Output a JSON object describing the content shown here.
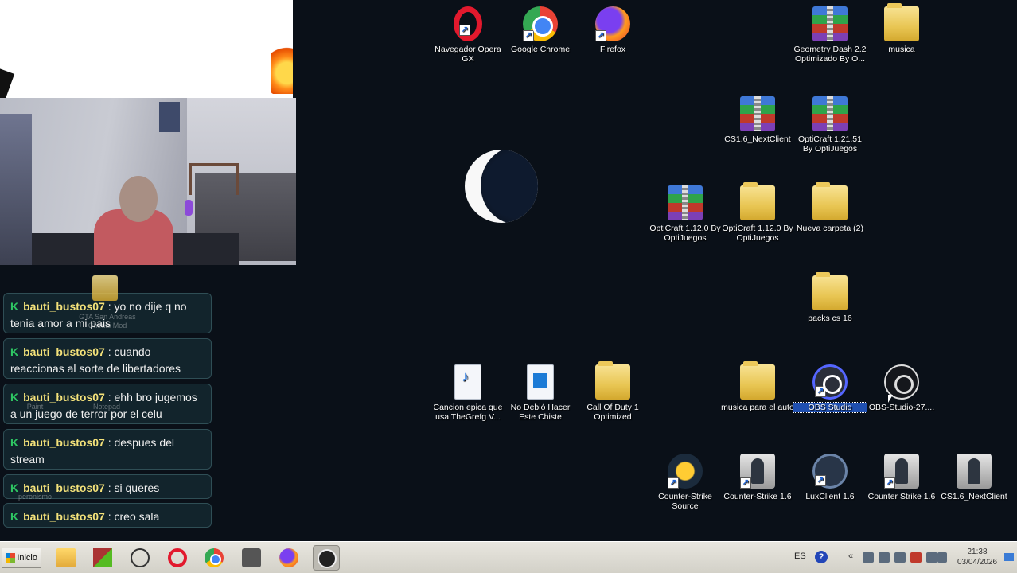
{
  "chat": {
    "badge": "K",
    "messages": [
      {
        "user": "bauti_bustos07",
        "text": ": yo no dije q no tenia amor a mi pais"
      },
      {
        "user": "bauti_bustos07",
        "text": ": cuando reaccionas al sorte de libertadores"
      },
      {
        "user": "bauti_bustos07",
        "text": ": ehh bro jugemos a un juego de terror por el celu"
      },
      {
        "user": "bauti_bustos07",
        "text": ": despues del stream"
      },
      {
        "user": "bauti_bustos07",
        "text": ": si queres"
      },
      {
        "user": "bauti_bustos07",
        "text": ": creo sala"
      }
    ]
  },
  "desktop": {
    "icons": [
      {
        "label": "Navegador Opera GX",
        "icon": "opera-icon",
        "shortcut": true
      },
      {
        "label": "Google Chrome",
        "icon": "chrome-icon",
        "shortcut": true
      },
      {
        "label": "Firefox",
        "icon": "firefox-icon",
        "shortcut": true
      },
      {
        "label": "Geometry Dash 2.2 Optimizado By O...",
        "icon": "winrar-archive-icon",
        "shortcut": false
      },
      {
        "label": "musica",
        "icon": "folder-icon",
        "shortcut": false
      },
      {
        "label": "CS1.6_NextClient",
        "icon": "winrar-archive-icon",
        "shortcut": false
      },
      {
        "label": "OptiCraft 1.21.51 By OptiJuegos",
        "icon": "winrar-archive-icon",
        "shortcut": false
      },
      {
        "label": "OptiCraft 1.12.0 By OptiJuegos",
        "icon": "winrar-archive-icon",
        "shortcut": false
      },
      {
        "label": "OptiCraft 1.12.0 By OptiJuegos",
        "icon": "folder-icon",
        "shortcut": false
      },
      {
        "label": "Nueva carpeta (2)",
        "icon": "folder-icon",
        "shortcut": false
      },
      {
        "label": "packs cs 16",
        "icon": "folder-icon",
        "shortcut": false
      },
      {
        "label": "Cancion epica que usa TheGrefg V...",
        "icon": "mp3-file-icon",
        "shortcut": false
      },
      {
        "label": "No Debió Hacer Este Chiste",
        "icon": "video-file-icon",
        "shortcut": false
      },
      {
        "label": "Call Of Duty 1 Optimized",
        "icon": "folder-icon",
        "shortcut": false
      },
      {
        "label": "musica para el auto",
        "icon": "folder-icon",
        "shortcut": false
      },
      {
        "label": "OBS Studio",
        "icon": "obs-icon",
        "shortcut": true
      },
      {
        "label": "OBS-Studio-27....",
        "icon": "obs-installer-icon",
        "shortcut": false
      },
      {
        "label": "Counter-Strike Source",
        "icon": "cs-source-icon",
        "shortcut": true
      },
      {
        "label": "Counter-Strike 1.6",
        "icon": "counter-strike-icon",
        "shortcut": true
      },
      {
        "label": "LuxClient 1.6",
        "icon": "luxclient-icon",
        "shortcut": true
      },
      {
        "label": "Counter Strike 1.6",
        "icon": "counter-strike-icon",
        "shortcut": true
      },
      {
        "label": "CS1.6_NextClient",
        "icon": "counter-strike-icon",
        "shortcut": false
      }
    ],
    "behind_chat": [
      "GTA San Andreas Cheats Mod",
      "Paint",
      "Notepad",
      "peronismo"
    ]
  },
  "taskbar": {
    "start_label": "Inicio",
    "apps": [
      "explorer-icon",
      "geometry-dash-icon",
      "cs-client-icon",
      "opera-icon",
      "chrome-icon",
      "counter-strike-icon",
      "firefox-icon",
      "obs-icon"
    ],
    "lang": "ES",
    "help": "?",
    "chevron": "«",
    "time": "21:38",
    "date": "03/04/2026"
  },
  "colors": {
    "desktop_bg": "#0a1018",
    "chat_user": "#f4e27a",
    "chat_badge": "#2ec763",
    "taskbar_bg": "#dddbd3",
    "selection": "#1f4fb0"
  }
}
